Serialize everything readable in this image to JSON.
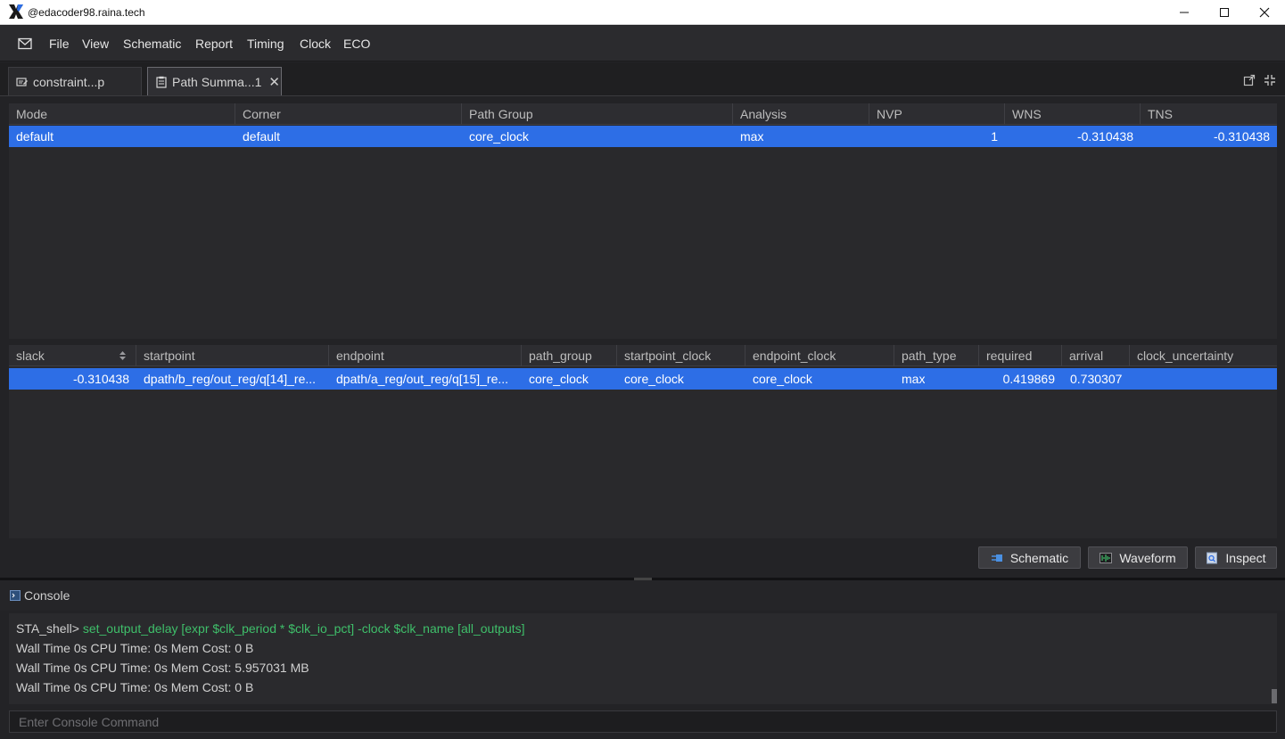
{
  "window": {
    "title": "@edacoder98.raina.tech",
    "controls": [
      "minimize-icon",
      "maximize-icon",
      "close-icon"
    ]
  },
  "menu": {
    "icon": "mail-icon",
    "items": [
      "File",
      "View",
      "Schematic",
      "Report",
      "Timing",
      "Clock",
      "ECO"
    ]
  },
  "tabs": [
    {
      "label": "constraint...p",
      "icon": "edit-doc-icon",
      "active": false
    },
    {
      "label": "Path Summa...1",
      "icon": "clipboard-icon",
      "active": true,
      "close": "✕"
    }
  ],
  "summary_table": {
    "columns": [
      "Mode",
      "Corner",
      "Path Group",
      "Analysis",
      "NVP",
      "WNS",
      "TNS"
    ],
    "rows": [
      {
        "mode": "default",
        "corner": "default",
        "path_group": "core_clock",
        "analysis": "max",
        "nvp": "1",
        "wns": "-0.310438",
        "tns": "-0.310438"
      }
    ]
  },
  "paths_table": {
    "columns": [
      "slack",
      "startpoint",
      "endpoint",
      "path_group",
      "startpoint_clock",
      "endpoint_clock",
      "path_type",
      "required",
      "arrival",
      "clock_uncertainty"
    ],
    "rows": [
      {
        "slack": "-0.310438",
        "startpoint": "dpath/b_reg/out_reg/q[14]_re...",
        "endpoint": "dpath/a_reg/out_reg/q[15]_re...",
        "path_group": "core_clock",
        "startpoint_clock": "core_clock",
        "endpoint_clock": "core_clock",
        "path_type": "max",
        "required": "0.419869",
        "arrival": "0.730307",
        "clock_uncertainty": ""
      }
    ]
  },
  "actions": {
    "schematic": "Schematic",
    "waveform": "Waveform",
    "inspect": "Inspect"
  },
  "console": {
    "title": "Console",
    "prompt": "STA_shell>",
    "command": "set_output_delay [expr $clk_period * $clk_io_pct] -clock $clk_name [all_outputs]",
    "lines": [
      "Wall Time 0s CPU Time: 0s Mem Cost: 0 B",
      "Wall Time 0s CPU Time: 0s Mem Cost: 5.957031 MB",
      "Wall Time 0s CPU Time: 0s Mem Cost: 0 B"
    ],
    "input_placeholder": "Enter Console Command"
  },
  "colors": {
    "selection": "#2d6ee6",
    "command": "#3fbf6a",
    "background": "#232326"
  }
}
